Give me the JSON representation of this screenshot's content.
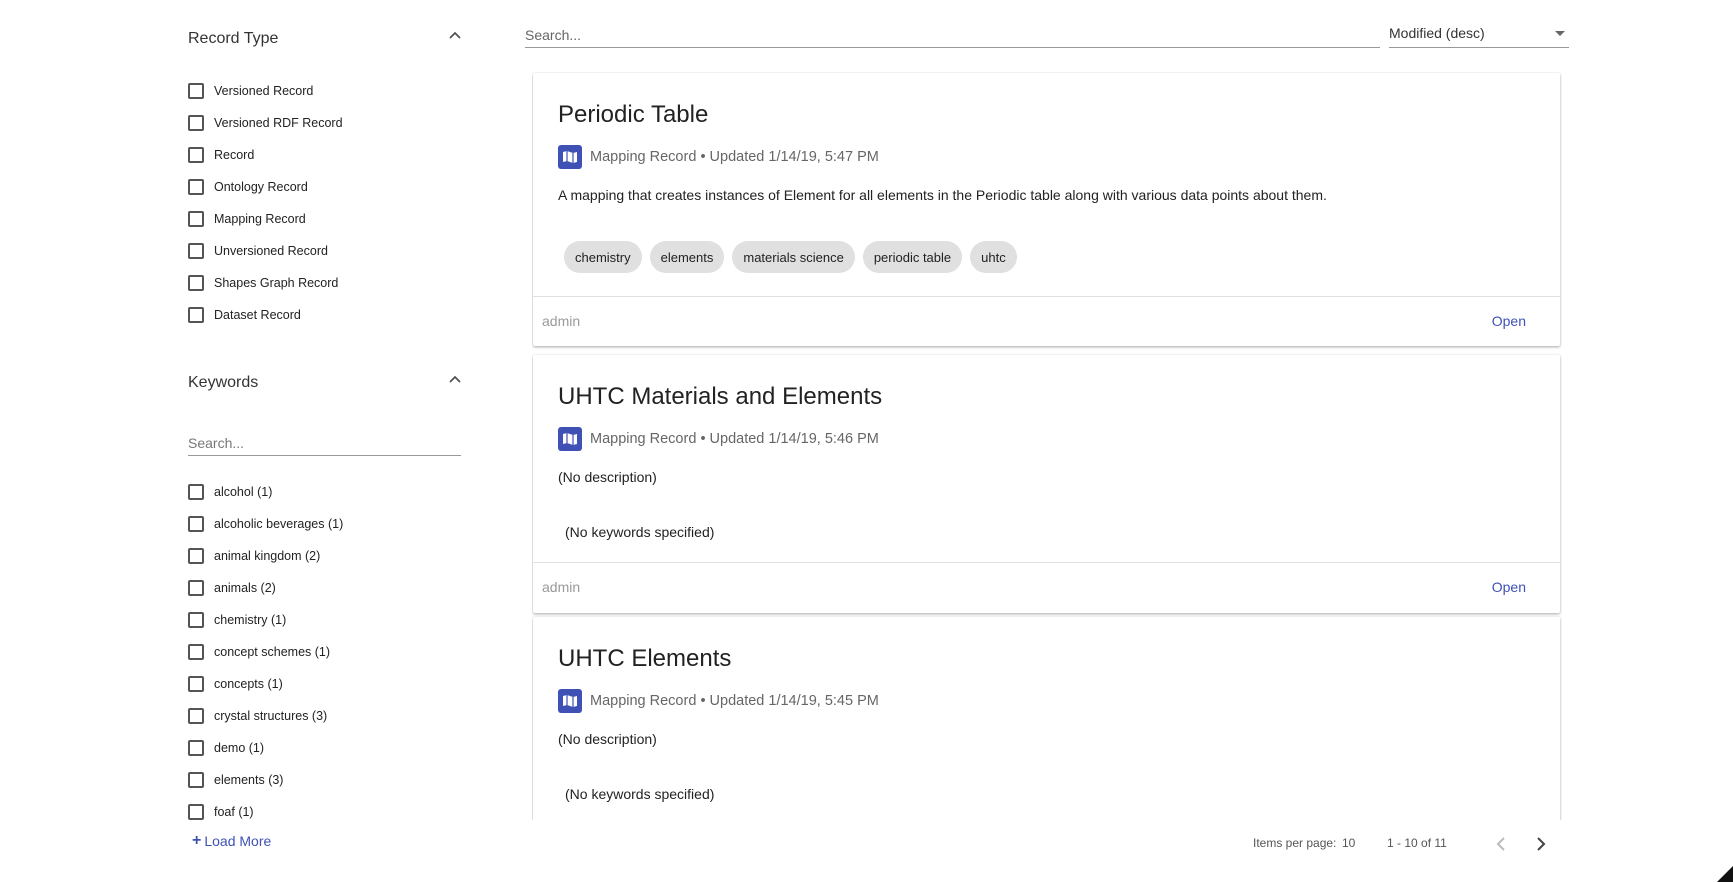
{
  "sidebar": {
    "record_type": {
      "title": "Record Type",
      "items": [
        "Versioned Record",
        "Versioned RDF Record",
        "Record",
        "Ontology Record",
        "Mapping Record",
        "Unversioned Record",
        "Shapes Graph Record",
        "Dataset Record"
      ]
    },
    "keywords": {
      "title": "Keywords",
      "search_placeholder": "Search...",
      "items": [
        "alcohol (1)",
        "alcoholic beverages (1)",
        "animal kingdom (2)",
        "animals (2)",
        "chemistry (1)",
        "concept schemes (1)",
        "concepts (1)",
        "crystal structures (3)",
        "demo (1)",
        "elements (3)",
        "foaf (1)"
      ],
      "load_more": "Load More"
    }
  },
  "toolbar": {
    "search_placeholder": "Search...",
    "sort_value": "Modified (desc)"
  },
  "records": [
    {
      "title": "Periodic Table",
      "type": "Mapping Record",
      "updated": "Updated 1/14/19, 5:47 PM",
      "separator": "•",
      "description": "A mapping that creates instances of Element for all elements in the Periodic table along with various data points about them.",
      "keywords": [
        "chemistry",
        "elements",
        "materials science",
        "periodic table",
        "uhtc"
      ],
      "user": "admin",
      "open_label": "Open"
    },
    {
      "title": "UHTC Materials and Elements",
      "type": "Mapping Record",
      "updated": "Updated 1/14/19, 5:46 PM",
      "separator": "•",
      "description": "(No description)",
      "no_keywords": "(No keywords specified)",
      "user": "admin",
      "open_label": "Open"
    },
    {
      "title": "UHTC Elements",
      "type": "Mapping Record",
      "updated": "Updated 1/14/19, 5:45 PM",
      "separator": "•",
      "description": "(No description)",
      "no_keywords": "(No keywords specified)"
    }
  ],
  "paginator": {
    "items_per_page_label": "Items per page:",
    "items_per_page_value": "10",
    "range": "1 - 10 of 11"
  },
  "icons": {
    "record_type": "map-icon",
    "section_toggle": "chevron-up-icon",
    "prev": "chevron-left-icon",
    "next": "chevron-right-icon",
    "load_more": "plus-icon"
  },
  "colors": {
    "accent": "#3f51b5",
    "chip_bg": "#e0e0e0",
    "muted_text": "#666666"
  }
}
